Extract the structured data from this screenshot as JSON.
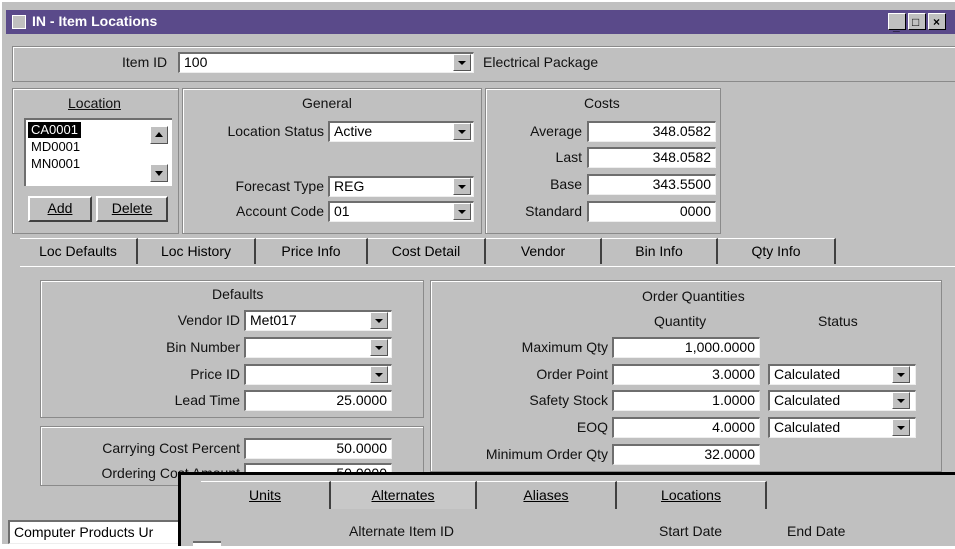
{
  "window": {
    "title": "IN - Item Locations"
  },
  "item": {
    "label": "Item ID",
    "value": "100",
    "description": "Electrical Package"
  },
  "location": {
    "header": "Location",
    "items": [
      "CA0001",
      "MD0001",
      "MN0001"
    ],
    "selected": "CA0001",
    "add_label": "Add",
    "delete_label": "Delete"
  },
  "general": {
    "header": "General",
    "status_label": "Location Status",
    "status_value": "Active",
    "forecast_label": "Forecast Type",
    "forecast_value": "REG",
    "account_label": "Account Code",
    "account_value": "01"
  },
  "costs": {
    "header": "Costs",
    "average_label": "Average",
    "average_value": "348.0582",
    "last_label": "Last",
    "last_value": "348.0582",
    "base_label": "Base",
    "base_value": "343.5500",
    "standard_label": "Standard",
    "standard_value": "0000"
  },
  "tabs": [
    "Loc Defaults",
    "Loc History",
    "Price Info",
    "Cost Detail",
    "Vendor",
    "Bin Info",
    "Qty Info"
  ],
  "defaults": {
    "header": "Defaults",
    "vendor_label": "Vendor ID",
    "vendor_value": "Met017",
    "bin_label": "Bin Number",
    "bin_value": "",
    "price_label": "Price ID",
    "price_value": "",
    "lead_label": "Lead Time",
    "lead_value": "25.0000",
    "carrying_label": "Carrying Cost Percent",
    "carrying_value": "50.0000",
    "ordering_label": "Ordering Cost Amount",
    "ordering_value": "50.0000"
  },
  "order": {
    "header": "Order Quantities",
    "qty_header": "Quantity",
    "status_header": "Status",
    "rows": [
      {
        "label": "Maximum Qty",
        "qty": "1,000.0000",
        "status": ""
      },
      {
        "label": "Order Point",
        "qty": "3.0000",
        "status": "Calculated"
      },
      {
        "label": "Safety Stock",
        "qty": "1.0000",
        "status": "Calculated"
      },
      {
        "label": "EOQ",
        "qty": "4.0000",
        "status": "Calculated"
      },
      {
        "label": "Minimum Order Qty",
        "qty": "32.0000",
        "status": ""
      }
    ]
  },
  "status_bar": {
    "text": "Computer Products Ur"
  },
  "popup": {
    "tabs": [
      "Units",
      "Alternates",
      "Aliases",
      "Locations"
    ],
    "columns": [
      "Alternate Item ID",
      "Start Date",
      "End Date"
    ]
  }
}
